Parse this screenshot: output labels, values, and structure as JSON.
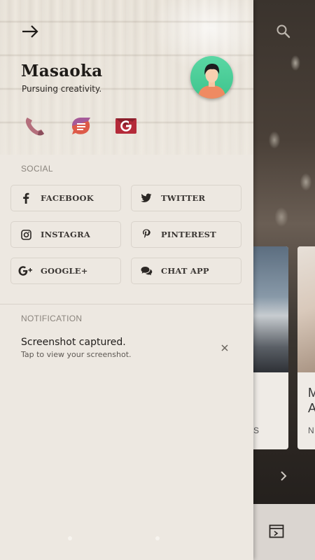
{
  "drawer": {
    "back_icon": "arrow-right-icon",
    "user_name": "Masaoka",
    "tagline": "Pursuing creativity.",
    "avatar_icon": "user-avatar",
    "quick_actions": [
      {
        "icon": "phone-icon",
        "color": "#b06a76"
      },
      {
        "icon": "message-icon",
        "color": "#d9584a"
      },
      {
        "icon": "gmail-icon",
        "color": "#b32d3a"
      }
    ]
  },
  "social": {
    "section_label": "SOCIAL",
    "buttons": [
      {
        "label": "FACEBOOK",
        "icon": "facebook-icon"
      },
      {
        "label": "TWITTER",
        "icon": "twitter-icon"
      },
      {
        "label": "INSTAGRA",
        "icon": "instagram-icon"
      },
      {
        "label": "PINTEREST",
        "icon": "pinterest-icon"
      },
      {
        "label": "GOOGLE+",
        "icon": "google-plus-icon"
      },
      {
        "label": "CHAT APP",
        "icon": "chat-icon"
      }
    ]
  },
  "notification": {
    "section_label": "NOTIFICATION",
    "title": "Screenshot captured.",
    "subtitle": "Tap to view your screenshot.",
    "dismiss_icon": "close-icon"
  },
  "background_app": {
    "search_icon": "search-icon",
    "card2_title": "M\nA",
    "card1_fragment": "S",
    "card2_fragment": "N",
    "next_icon": "chevron-right-icon",
    "bottom_icon": "browser-icon"
  },
  "colors": {
    "drawer_bg": "#ede8e1",
    "avatar_bg": "#4fd19b",
    "text_dark": "#1e1b18"
  }
}
